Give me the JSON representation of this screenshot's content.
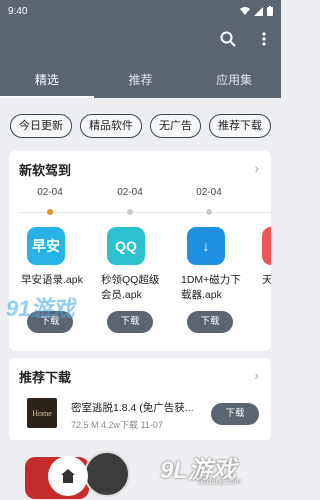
{
  "status": {
    "time": "9:40"
  },
  "tabs": [
    {
      "label": "精选"
    },
    {
      "label": "推荐"
    },
    {
      "label": "应用集"
    }
  ],
  "chips": [
    {
      "label": "今日更新"
    },
    {
      "label": "精品软件"
    },
    {
      "label": "无广告"
    },
    {
      "label": "推荐下载"
    }
  ],
  "new_section": {
    "title": "新软驾到",
    "dates": [
      "02-04",
      "02-04",
      "02-04"
    ],
    "apps": [
      {
        "name": "早安语录.apk",
        "icon": "早安",
        "color": "#27b3e6",
        "download": "下载"
      },
      {
        "name": "秒领QQ超级会员.apk",
        "icon": "QQ",
        "color": "#2ac1d1",
        "download": "下载"
      },
      {
        "name": "1DM+磁力下载器.apk",
        "icon": "↓",
        "color": "#1f8fe0",
        "download": "下载"
      },
      {
        "name": "天v.",
        "icon": "",
        "color": "#e55",
        "download": "下"
      }
    ]
  },
  "rec_section": {
    "title": "推荐下载",
    "items": [
      {
        "title": "密室逃脱1.8.4 (免广告获...",
        "size": "72.5 M",
        "downloads": "4.2w下载",
        "date": "11-07",
        "download": "下载",
        "icon_text": "Home"
      }
    ]
  },
  "watermarks": {
    "w1_main": "91游戏",
    "w1_sub": "91danji.com",
    "w2_main": "9L游戏",
    "w2_sub": "91danji.com"
  }
}
